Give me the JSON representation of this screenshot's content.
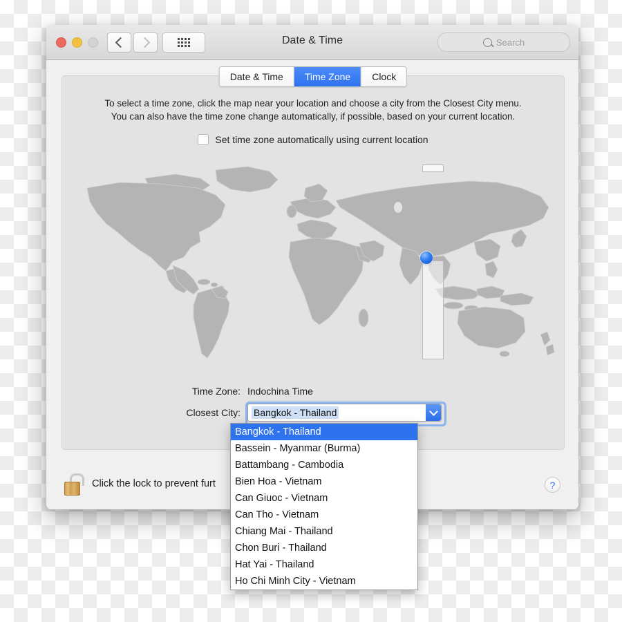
{
  "window": {
    "title": "Date & Time",
    "traffic_lights": [
      "close",
      "minimize",
      "zoom"
    ],
    "nav": {
      "back_icon": "chevron-left-icon",
      "forward_icon": "chevron-right-icon"
    },
    "grid_button_icon": "grid-view-icon",
    "search": {
      "placeholder": "Search",
      "icon": "search-icon"
    }
  },
  "tabs": [
    {
      "label": "Date & Time",
      "active": false
    },
    {
      "label": "Time Zone",
      "active": true
    },
    {
      "label": "Clock",
      "active": false
    }
  ],
  "instructions": {
    "line1": "To select a time zone, click the map near your location and choose a city from the Closest City menu.",
    "line2": "You can also have the time zone change automatically, if possible, based on your current location."
  },
  "auto_checkbox": {
    "label": "Set time zone automatically using current location",
    "checked": false
  },
  "map": {
    "icon": "world-map",
    "pin_icon": "location-pin-icon",
    "land_color": "#b4b4b4",
    "ocean_color": "#e3e3e3",
    "highlight_color": "#f3f3f3"
  },
  "fields": {
    "time_zone_label": "Time Zone:",
    "time_zone_value": "Indochina Time",
    "closest_city_label": "Closest City:",
    "closest_city_value": "Bangkok - Thailand",
    "dropdown_arrow_icon": "chevron-down-icon"
  },
  "dropdown": {
    "options": [
      "Bangkok - Thailand",
      "Bassein - Myanmar (Burma)",
      "Battambang - Cambodia",
      "Bien Hoa - Vietnam",
      "Can Giuoc - Vietnam",
      "Can Tho - Vietnam",
      "Chiang Mai - Thailand",
      "Chon Buri - Thailand",
      "Hat Yai - Thailand",
      "Ho Chi Minh City - Vietnam"
    ],
    "selected_index": 0
  },
  "footer": {
    "lock_icon": "unlocked-padlock-icon",
    "lock_text": "Click the lock to prevent furt",
    "help_label": "?"
  },
  "colors": {
    "accent_blue": "#2f72ee",
    "tab_active_blue": "#3b7ff5",
    "panel_bg": "#e3e3e3",
    "window_bg": "#f0f0f0",
    "lock_gold": "#d6a857"
  }
}
